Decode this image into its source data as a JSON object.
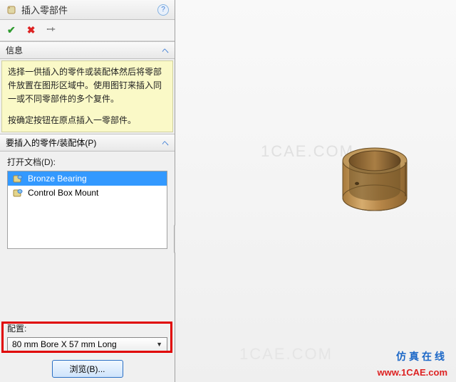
{
  "header": {
    "title": "插入零部件"
  },
  "info": {
    "title": "信息",
    "paragraph1": "选择一供插入的零件或装配体然后将零部件放置在图形区域中。使用图钉来插入同一或不同零部件的多个复件。",
    "paragraph2": "按确定按钮在原点插入一零部件。"
  },
  "parts_section": {
    "title": "要插入的零件/装配体(P)",
    "open_doc_label": "打开文档(D):",
    "items": [
      {
        "name": "Bronze Bearing",
        "selected": true
      },
      {
        "name": "Control Box Mount",
        "selected": false
      }
    ]
  },
  "config": {
    "label": "配置:",
    "value": "80 mm Bore X 57 mm Long"
  },
  "browse": {
    "label": "浏览(B)..."
  },
  "watermark": "1CAE.COM",
  "footer": {
    "line1": "仿真在线",
    "line2": "www.1CAE.com"
  }
}
